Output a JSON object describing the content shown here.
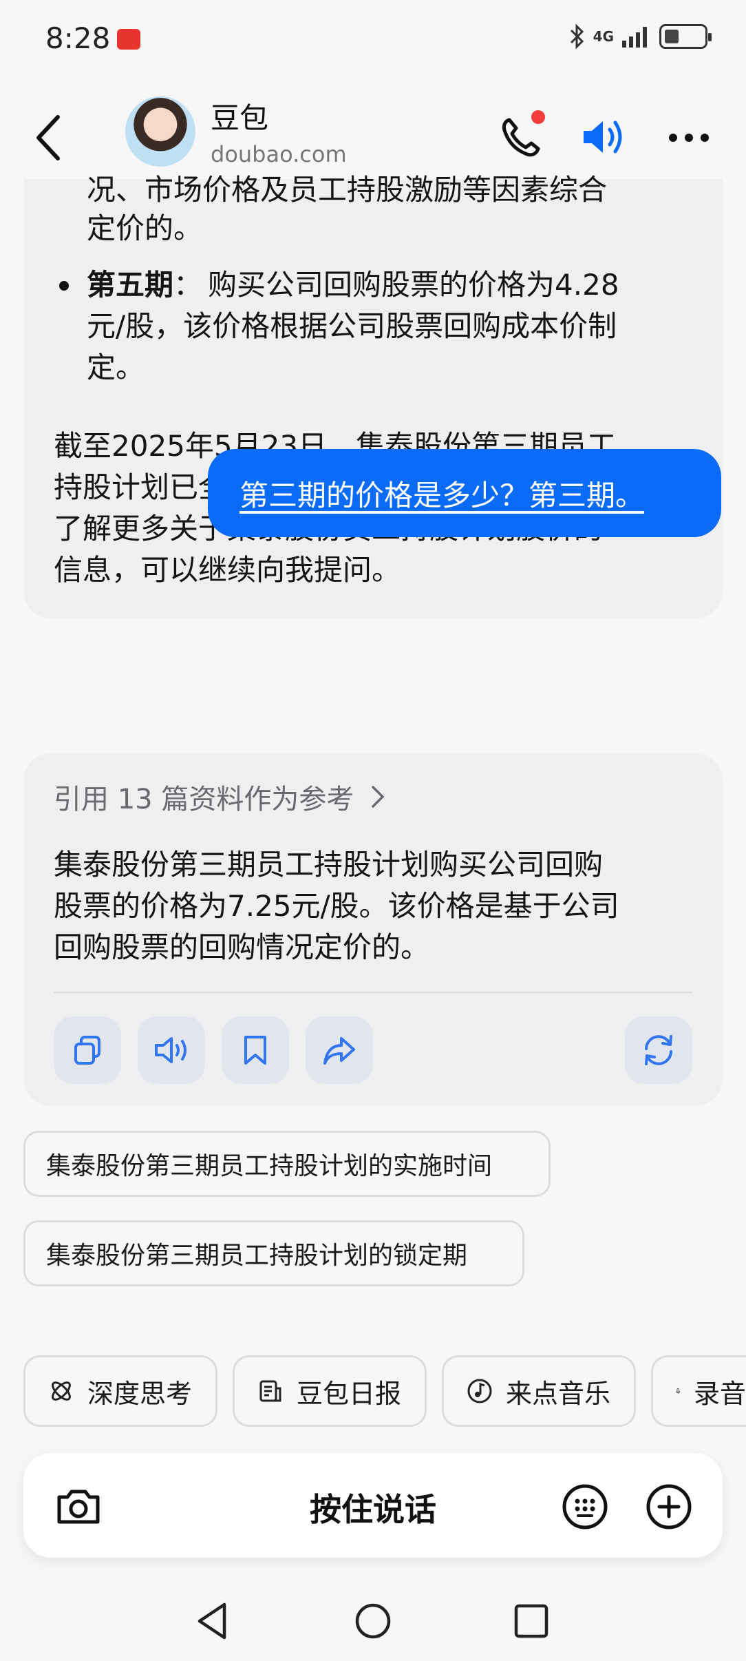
{
  "status_bar": {
    "time": "8:28",
    "network": "4G"
  },
  "header": {
    "name": "豆包",
    "domain": "doubao.com"
  },
  "previous_answer": {
    "clipped_line": "况、市场价格及员工持股激励等因素综合",
    "line_tail": "定价的。",
    "fifth_label": "第五期",
    "fifth_sep": "：",
    "fifth_lines": [
      "购买公司回购股票的价格为4.28",
      "元/股，该价格根据公司股票回购成本价制",
      "定。"
    ],
    "closing_lines": [
      "截至2025年5月23日，集泰股份第三期员工",
      "持股计划已全部出售完毕并正式终止。若想",
      "了解更多关于集泰股份员工持股计划股价的",
      "信息，可以继续向我提问。"
    ]
  },
  "user_message": "第三期的价格是多少？第三期。",
  "answer": {
    "reference_text": "引用 13 篇资料作为参考",
    "lines": [
      "集泰股份第三期员工持股计划购买公司回购",
      "股票的价格为7.25元/股。该价格是基于公司",
      "回购股票的回购情况定价的。"
    ]
  },
  "suggestions": [
    "集泰股份第三期员工持股计划的实施时间",
    "集泰股份第三期员工持股计划的锁定期"
  ],
  "quick_chips": [
    "深度思考",
    "豆包日报",
    "来点音乐",
    "录音"
  ],
  "input_bar": {
    "hold_to_talk": "按住说话"
  },
  "colors": {
    "accent": "#0a6cf6",
    "bubble_ai": "#efeff1",
    "notification": "#f23b3b"
  },
  "icons": [
    "back-icon",
    "phone-icon",
    "speaker-icon",
    "more-icon",
    "copy-icon",
    "read-aloud-icon",
    "bookmark-icon",
    "share-icon",
    "regenerate-icon",
    "atom-icon",
    "news-icon",
    "music-icon",
    "mic-icon",
    "camera-icon",
    "emoji-keyboard-icon",
    "plus-icon"
  ]
}
